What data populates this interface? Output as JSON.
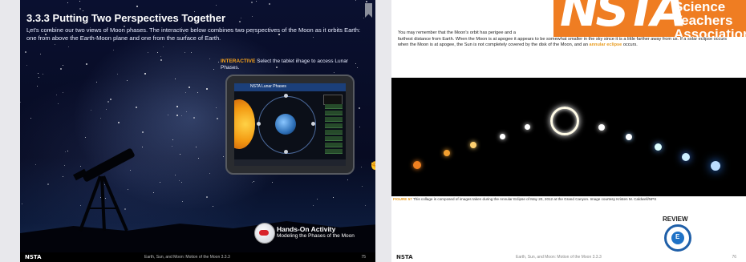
{
  "left_page": {
    "title": "3.3.3 Putting Two Perspectives Together",
    "intro": "Let's combine our two views of Moon phases. The interactive below combines two perspectives of the Moon as it orbits Earth: one from above the Earth-Moon plane and one from the surface of Earth.",
    "interactive_label": "INTERACTIVE",
    "interactive_text": "Select the tablet image to access Lunar Phases.",
    "tablet_title": "NSTA Lunar Phases",
    "hands_on_title": "Hands-On Activity",
    "hands_on_subtitle": "Modeling the Phases of the Moon",
    "footer_logo": "NSTA",
    "footer_text": "Earth, Sun, and Moon: Motion of the Moon 3.3.3",
    "page_number": "75"
  },
  "right_page": {
    "text_before": "You may remember that the Moon's orbit has perigee and a",
    "text_main": "farthest distance from Earth. When the Moon is at apogee it appears to be somewhat smaller in the sky since it is a little farther away from us. If a solar eclipse occurs when the Moon is at apogee, the Sun is not completely covered by the disk of the Moon, and an",
    "highlight": "annular eclipse",
    "text_after": "occurs.",
    "figure_label": "FIGURE 57",
    "figure_caption": "This collage is composed of images taken during the Annular Eclipse of May 20, 2012 at the Grand Canyon. Image courtesy Kristen M. Caldwell/NPS",
    "review_label": "REVIEW",
    "review_icon_letter": "E",
    "footer_logo": "NSTA",
    "footer_text": "Earth, Sun, and Moon: Motion of the Moon 3.3.3",
    "page_number": "76"
  },
  "logo": {
    "letters": "NSTA",
    "line1": "Science",
    "line2": "Teachers",
    "line3": "Association"
  },
  "colors": {
    "accent_orange": "#ef7d22",
    "highlight": "#e89b1c",
    "review_blue": "#1f5fa8"
  }
}
